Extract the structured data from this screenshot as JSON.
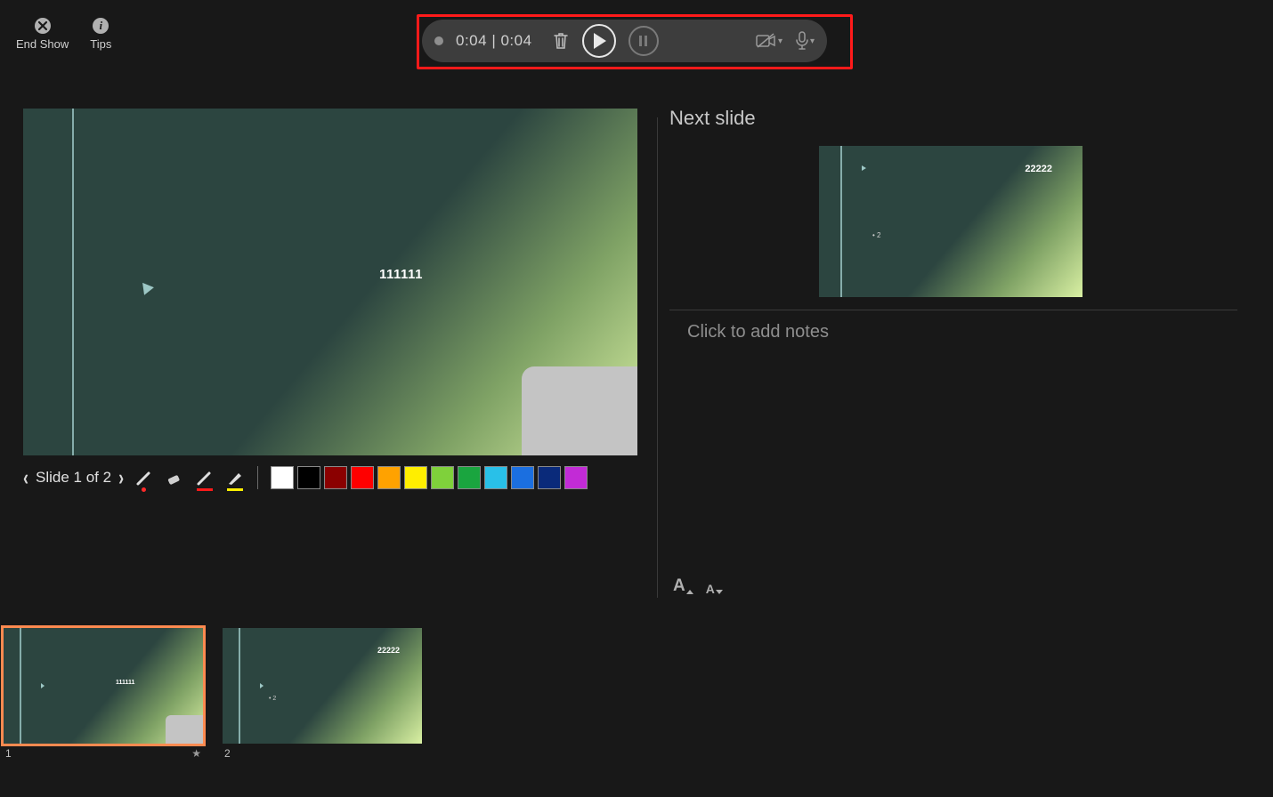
{
  "toolbar": {
    "end_show": "End Show",
    "tips": "Tips"
  },
  "recording": {
    "elapsed": "0:04",
    "total": "0:04"
  },
  "slides": {
    "current_title": "111111",
    "next_title": "22222",
    "next_bullet": "• 2",
    "nav_label": "Slide 1 of 2",
    "count": 2,
    "current": 1
  },
  "panels": {
    "next_slide_label": "Next slide",
    "notes_placeholder": "Click to add notes"
  },
  "colors": [
    "#ffffff",
    "#000000",
    "#8b0000",
    "#ff0000",
    "#ffa200",
    "#ffee00",
    "#7fd13b",
    "#1aa53f",
    "#29c0e8",
    "#1b6fe0",
    "#0a2a7a",
    "#c22bd6"
  ],
  "thumbnails": [
    {
      "number": "1",
      "title": "111111",
      "has_camera": true,
      "selected": true,
      "starred": true
    },
    {
      "number": "2",
      "title": "22222",
      "bullet": "• 2",
      "has_camera": false,
      "selected": false,
      "starred": false
    }
  ],
  "font_controls": {
    "big": "A",
    "small": "A"
  }
}
